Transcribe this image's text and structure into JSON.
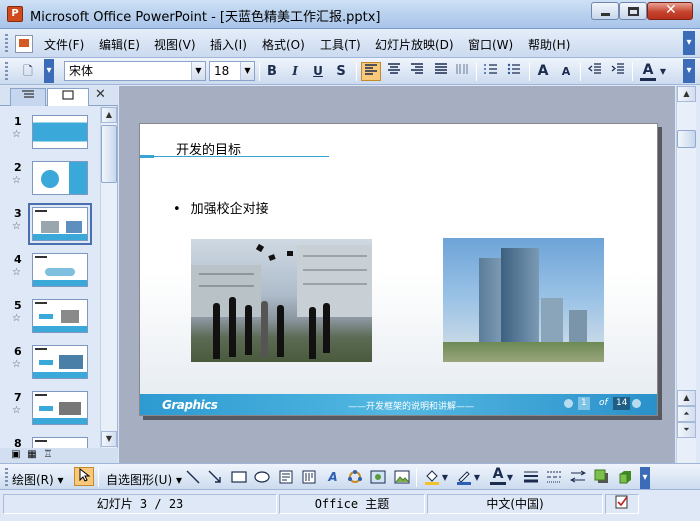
{
  "window": {
    "title": "Microsoft Office PowerPoint - [天蓝色精美工作汇报.pptx]",
    "app_icon": "powerpoint-icon",
    "minimize_glyph": "",
    "maximize_glyph": "",
    "close_glyph": "✕"
  },
  "menu": {
    "items": [
      {
        "label": "文件(F)"
      },
      {
        "label": "编辑(E)"
      },
      {
        "label": "视图(V)"
      },
      {
        "label": "插入(I)"
      },
      {
        "label": "格式(O)"
      },
      {
        "label": "工具(T)"
      },
      {
        "label": "幻灯片放映(D)"
      },
      {
        "label": "窗口(W)"
      },
      {
        "label": "帮助(H)"
      }
    ]
  },
  "format_toolbar": {
    "font_name": "宋体",
    "font_size": "18",
    "bold": "B",
    "italic": "I",
    "underline": "U",
    "shadow": "S",
    "font_color_glyph": "A",
    "grow_font_glyph": "A",
    "shrink_font_glyph": "A"
  },
  "left_panel": {
    "close_glyph": "✕",
    "slides": [
      {
        "number": "1"
      },
      {
        "number": "2"
      },
      {
        "number": "3",
        "selected": true
      },
      {
        "number": "4"
      },
      {
        "number": "5"
      },
      {
        "number": "6"
      },
      {
        "number": "7"
      },
      {
        "number": "8"
      }
    ]
  },
  "slide": {
    "title": "开发的目标",
    "bullet": "加强校企对接",
    "bullet_marker": "•",
    "footer_logo": "Graphics",
    "footer_text": "——开发框架的说明和讲解——",
    "nav_current": "1",
    "nav_of": "of",
    "nav_total": "14"
  },
  "draw_toolbar": {
    "draw_label": "绘图(R)",
    "autoshapes_label": "自选图形(U)"
  },
  "status_bar": {
    "slide_info": "幻灯片 3 / 23",
    "theme": "Office 主题",
    "language": "中文(中国)"
  },
  "colors": {
    "accent_blue": "#3aa3d3",
    "title_bar": "#b9d1ee",
    "close_red": "#c6452f"
  }
}
